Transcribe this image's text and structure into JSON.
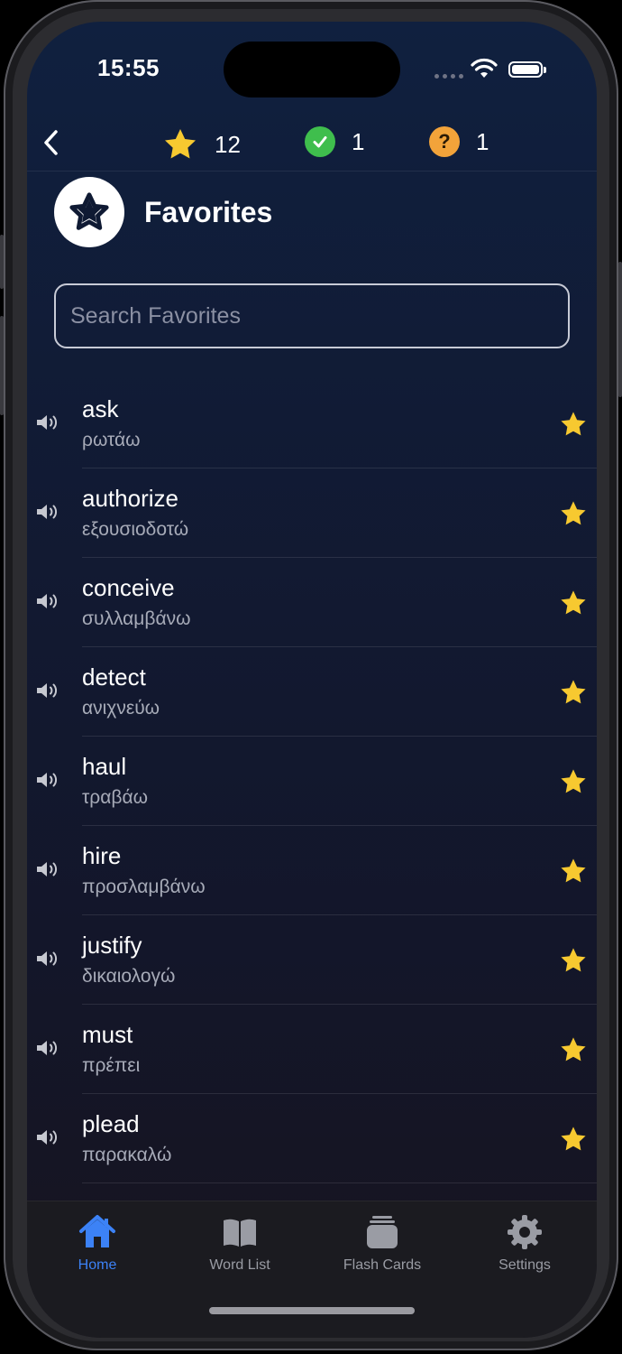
{
  "status": {
    "time": "15:55"
  },
  "nav": {
    "back_icon": "chevron-left-icon",
    "stats": [
      {
        "icon": "star-icon",
        "value": "12",
        "color": "#f7c930"
      },
      {
        "icon": "check-circle-icon",
        "value": "1",
        "color": "#3fbe4d"
      },
      {
        "icon": "question-circle-icon",
        "value": "1",
        "color": "#f2a33a"
      }
    ]
  },
  "header": {
    "title": "Favorites",
    "icon": "star-icon"
  },
  "search": {
    "placeholder": "Search Favorites",
    "value": ""
  },
  "words": [
    {
      "word": "ask",
      "translation": "ρωτάω"
    },
    {
      "word": "authorize",
      "translation": "εξουσιοδοτώ"
    },
    {
      "word": "conceive",
      "translation": "συλλαμβάνω"
    },
    {
      "word": "detect",
      "translation": "ανιχνεύω"
    },
    {
      "word": "haul",
      "translation": "τραβάω"
    },
    {
      "word": "hire",
      "translation": "προσλαμβάνω"
    },
    {
      "word": "justify",
      "translation": "δικαιολογώ"
    },
    {
      "word": "must",
      "translation": "πρέπει"
    },
    {
      "word": "plead",
      "translation": "παρακαλώ"
    }
  ],
  "tabs": [
    {
      "label": "Home",
      "icon": "house-icon",
      "active": true
    },
    {
      "label": "Word List",
      "icon": "book-icon",
      "active": false
    },
    {
      "label": "Flash Cards",
      "icon": "cards-icon",
      "active": false
    },
    {
      "label": "Settings",
      "icon": "gear-icon",
      "active": false
    }
  ],
  "colors": {
    "accent": "#3c82f6",
    "star": "#f7c930",
    "background": "#111b35"
  }
}
